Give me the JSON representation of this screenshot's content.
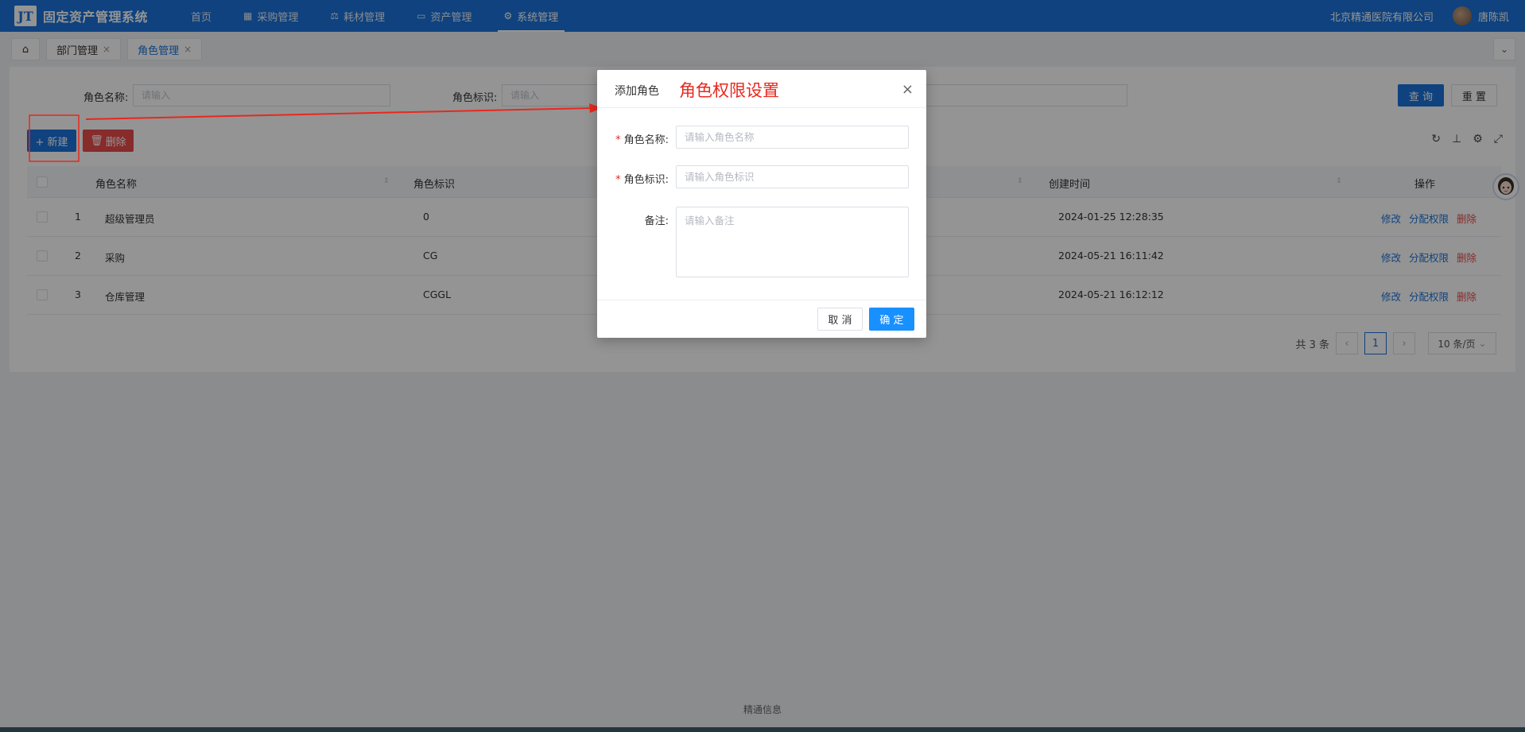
{
  "header": {
    "logo_mark": "JT",
    "app_title": "固定资产管理系统",
    "nav": [
      {
        "label": "首页",
        "icon": ""
      },
      {
        "label": "采购管理",
        "icon": "grid-icon"
      },
      {
        "label": "耗材管理",
        "icon": "scale-icon"
      },
      {
        "label": "资产管理",
        "icon": "calendar-icon"
      },
      {
        "label": "系统管理",
        "icon": "gear-icon"
      }
    ],
    "company": "北京精通医院有限公司",
    "username": "唐陈凯"
  },
  "tabs": [
    {
      "label": "部门管理"
    },
    {
      "label": "角色管理"
    }
  ],
  "search": {
    "role_name_label": "角色名称:",
    "role_name_placeholder": "请输入",
    "role_key_label": "角色标识:",
    "role_key_placeholder": "请输入",
    "query_label": "查 询",
    "reset_label": "重 置"
  },
  "toolbar": {
    "new_label": "+ 新建",
    "delete_label": "删除"
  },
  "table": {
    "columns": [
      "角色名称",
      "角色标识",
      "创建时间",
      "操作"
    ],
    "rows": [
      {
        "index": "1",
        "name": "超级管理员",
        "key": "0",
        "created": "2024-01-25 12:28:35"
      },
      {
        "index": "2",
        "name": "采购",
        "key": "CG",
        "created": "2024-05-21 16:11:42"
      },
      {
        "index": "3",
        "name": "仓库管理",
        "key": "CGGL",
        "created": "2024-05-21 16:12:12"
      }
    ],
    "actions": {
      "edit": "修改",
      "assign": "分配权限",
      "delete": "删除"
    }
  },
  "pagination": {
    "total": "共 3 条",
    "current": "1",
    "page_size": "10 条/页"
  },
  "footer": "精通信息",
  "dialog": {
    "title": "添加角色",
    "annotation": "角色权限设置",
    "fields": {
      "name_label": "角色名称:",
      "name_placeholder": "请输入角色名称",
      "key_label": "角色标识:",
      "key_placeholder": "请输入角色标识",
      "remark_label": "备注:",
      "remark_placeholder": "请输入备注"
    },
    "cancel_label": "取 消",
    "confirm_label": "确 定"
  },
  "colors": {
    "primary": "#1a73d9",
    "danger": "#e84a4a",
    "annotation_red": "#e8281e"
  }
}
